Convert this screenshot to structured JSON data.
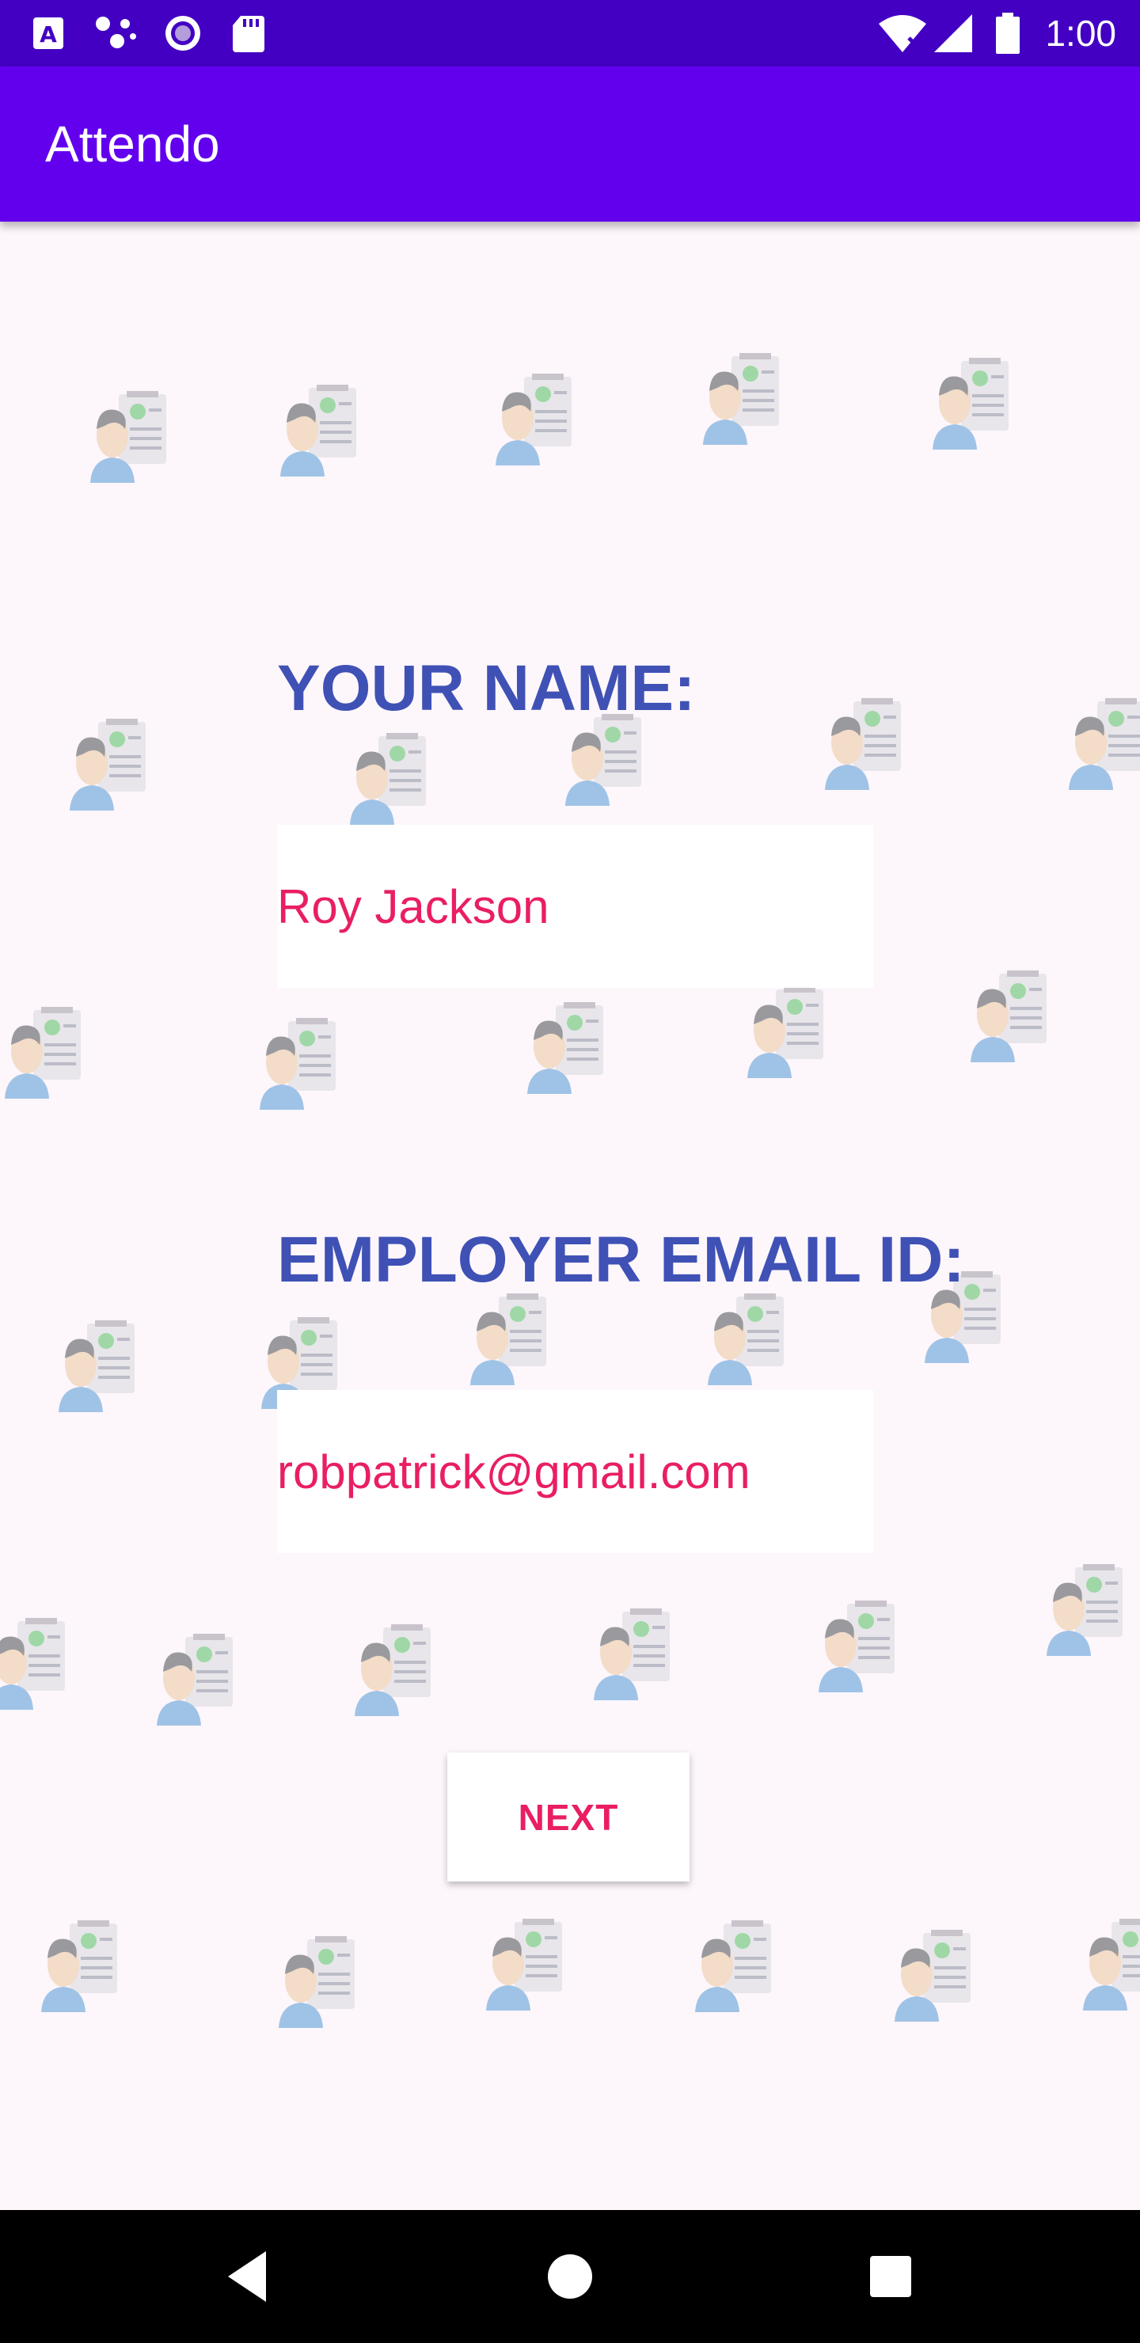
{
  "status_bar": {
    "time": "1:00",
    "icons": [
      "a-icon",
      "dots-icon",
      "record-icon",
      "sdcard-icon",
      "wifi-icon",
      "signal-icon",
      "battery-icon"
    ]
  },
  "app_bar": {
    "title": "Attendo"
  },
  "form": {
    "name_label": "YOUR NAME:",
    "name_value": "Roy Jackson",
    "email_label": "EMPLOYER EMAIL ID:",
    "email_value": "robpatrick@gmail.com",
    "next_label": "NEXT"
  },
  "colors": {
    "status_bar": "#4300c2",
    "app_bar": "#6200ee",
    "label": "#3f51b5",
    "accent": "#e91e63",
    "background": "#fdf6fb"
  },
  "nav_bar": {
    "buttons": [
      "back-icon",
      "home-icon",
      "recents-icon"
    ]
  }
}
